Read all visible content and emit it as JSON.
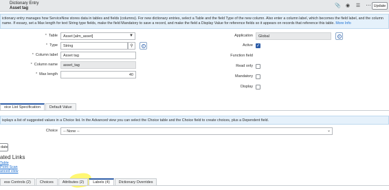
{
  "header": {
    "title_line1": "Dictionary Entry",
    "title_line2": "Asset tag",
    "icons": [
      "attachment-icon",
      "activity-icon",
      "settings-sliders-icon",
      "more-icon"
    ],
    "update_label": "Update"
  },
  "intro": {
    "text": "ictionary entry manages how ServiceNow stores data in tables and fields (columns). For new dictionary entries, select a Table and the field Type of the new column. Also enter a column label, which becomes the field label, and the column name. If essary, set a Max length for text String type fields, make the field Mandatory to save a record, and make the field a Display Value for reference fields so it appears on records that reference this table.",
    "link": "More Info"
  },
  "form": {
    "table_label": "Table",
    "table_value": "Asset [alm_asset]",
    "type_label": "Type",
    "type_value": "String",
    "column_label_label": "Column label",
    "column_label_value": "Asset tag",
    "column_name_label": "Column name",
    "column_name_value": "asset_tag",
    "max_length_label": "Max length",
    "max_length_value": "40",
    "application_label": "Application",
    "application_value": "Global",
    "active_label": "Active",
    "active_checked": true,
    "function_field_label": "Function field",
    "read_only_label": "Read only",
    "mandatory_label": "Mandatory",
    "display_label": "Display"
  },
  "section_tabs": [
    {
      "label": "oice List Specification",
      "active": true
    },
    {
      "label": "Default Value",
      "active": false
    }
  ],
  "choice_section": {
    "info": "isplays a list of suggested values in a Choice list. In the Advanced view you can select the Choice table and the Choice field to create choices, plus a Dependent field.",
    "choice_label": "Choice",
    "choice_value": "-- None --"
  },
  "update_button2": "date",
  "related": {
    "title": "ated Links",
    "links": [
      "Table",
      "Point Scan",
      "anced view"
    ]
  },
  "related_tabs": [
    {
      "label": "ess Controls (2)"
    },
    {
      "label": "Choices"
    },
    {
      "label": "Attributes (2)"
    },
    {
      "label": "Labels (4)"
    },
    {
      "label": "Dictionary Overrides"
    }
  ]
}
